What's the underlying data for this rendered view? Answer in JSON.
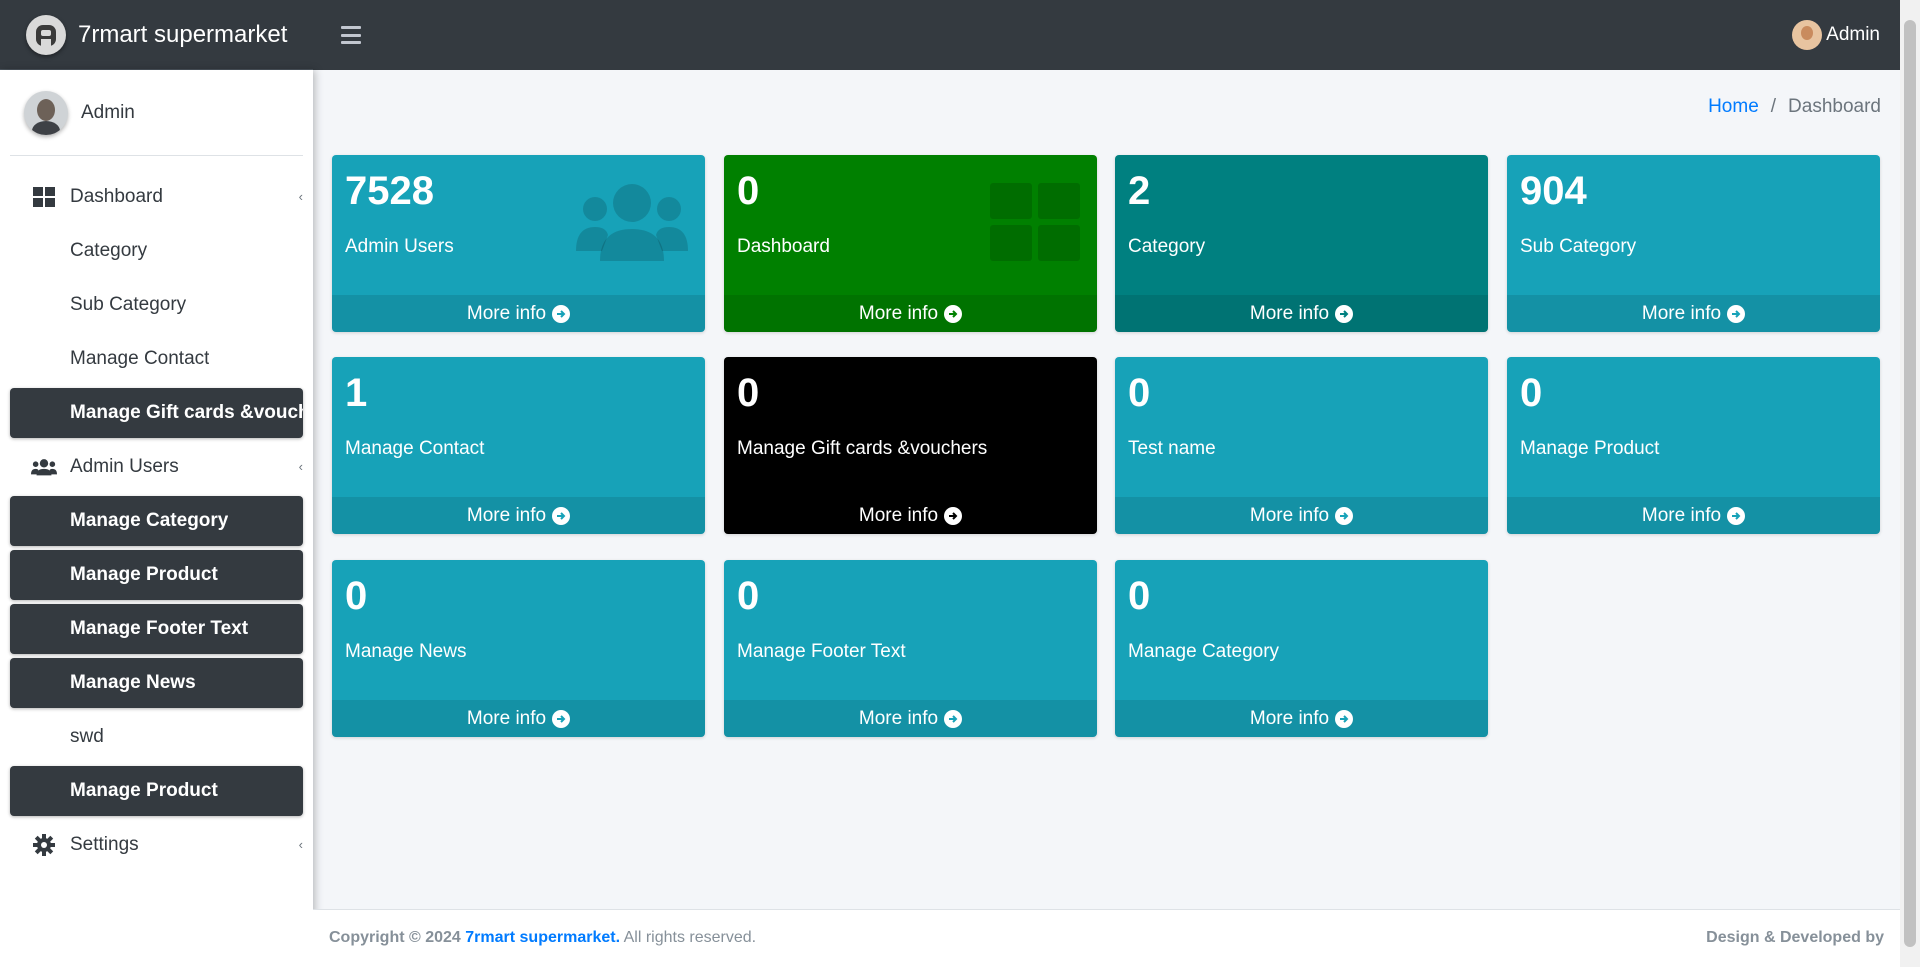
{
  "brand": {
    "name": "7rmart supermarket"
  },
  "topbar": {
    "user": "Admin",
    "menu_icon": "hamburger-icon"
  },
  "sidebar": {
    "user": "Admin",
    "items": [
      {
        "label": "Dashboard",
        "icon": "dashboard-icon",
        "active": false,
        "caret": true
      },
      {
        "label": "Category",
        "active": false
      },
      {
        "label": "Sub Category",
        "active": false
      },
      {
        "label": "Manage Contact",
        "active": false
      },
      {
        "label": "Manage Gift cards &vouchers",
        "active": true
      },
      {
        "label": "Admin Users",
        "icon": "users-icon",
        "active": false,
        "caret": true
      },
      {
        "label": "Manage Category",
        "active": true
      },
      {
        "label": "Manage Product",
        "active": true
      },
      {
        "label": "Manage Footer Text",
        "active": true
      },
      {
        "label": "Manage News",
        "active": true
      },
      {
        "label": "swd",
        "active": false
      },
      {
        "label": "Manage Product",
        "active": true
      },
      {
        "label": "Settings",
        "icon": "gear-icon",
        "active": false,
        "caret": true
      }
    ]
  },
  "breadcrumb": {
    "home": "Home",
    "separator": "/",
    "current": "Dashboard"
  },
  "boxes": [
    {
      "number": "7528",
      "label": "Admin Users",
      "color": "#17a2b8",
      "more": "More info",
      "icon": "users-icon"
    },
    {
      "number": "0",
      "label": "Dashboard",
      "color": "#008000",
      "more": "More info",
      "icon": "dashboard-icon"
    },
    {
      "number": "2",
      "label": "Category",
      "color": "#008080",
      "more": "More info"
    },
    {
      "number": "904",
      "label": "Sub Category",
      "color": "#17a2b8",
      "more": "More info"
    },
    {
      "number": "1",
      "label": "Manage Contact",
      "color": "#17a2b8",
      "more": "More info"
    },
    {
      "number": "0",
      "label": "Manage Gift cards &vouchers",
      "color": "#000000",
      "more": "More info"
    },
    {
      "number": "0",
      "label": "Test name",
      "color": "#17a2b8",
      "more": "More info"
    },
    {
      "number": "0",
      "label": "Manage Product",
      "color": "#17a2b8",
      "more": "More info"
    },
    {
      "number": "0",
      "label": "Manage News",
      "color": "#17a2b8",
      "more": "More info"
    },
    {
      "number": "0",
      "label": "Manage Footer Text",
      "color": "#17a2b8",
      "more": "More info"
    },
    {
      "number": "0",
      "label": "Manage Category",
      "color": "#17a2b8",
      "more": "More info"
    }
  ],
  "footer": {
    "copyright": "Copyright © 2024",
    "company": "7rmart supermarket.",
    "rights": "All rights reserved.",
    "credit": "Design & Developed by"
  }
}
